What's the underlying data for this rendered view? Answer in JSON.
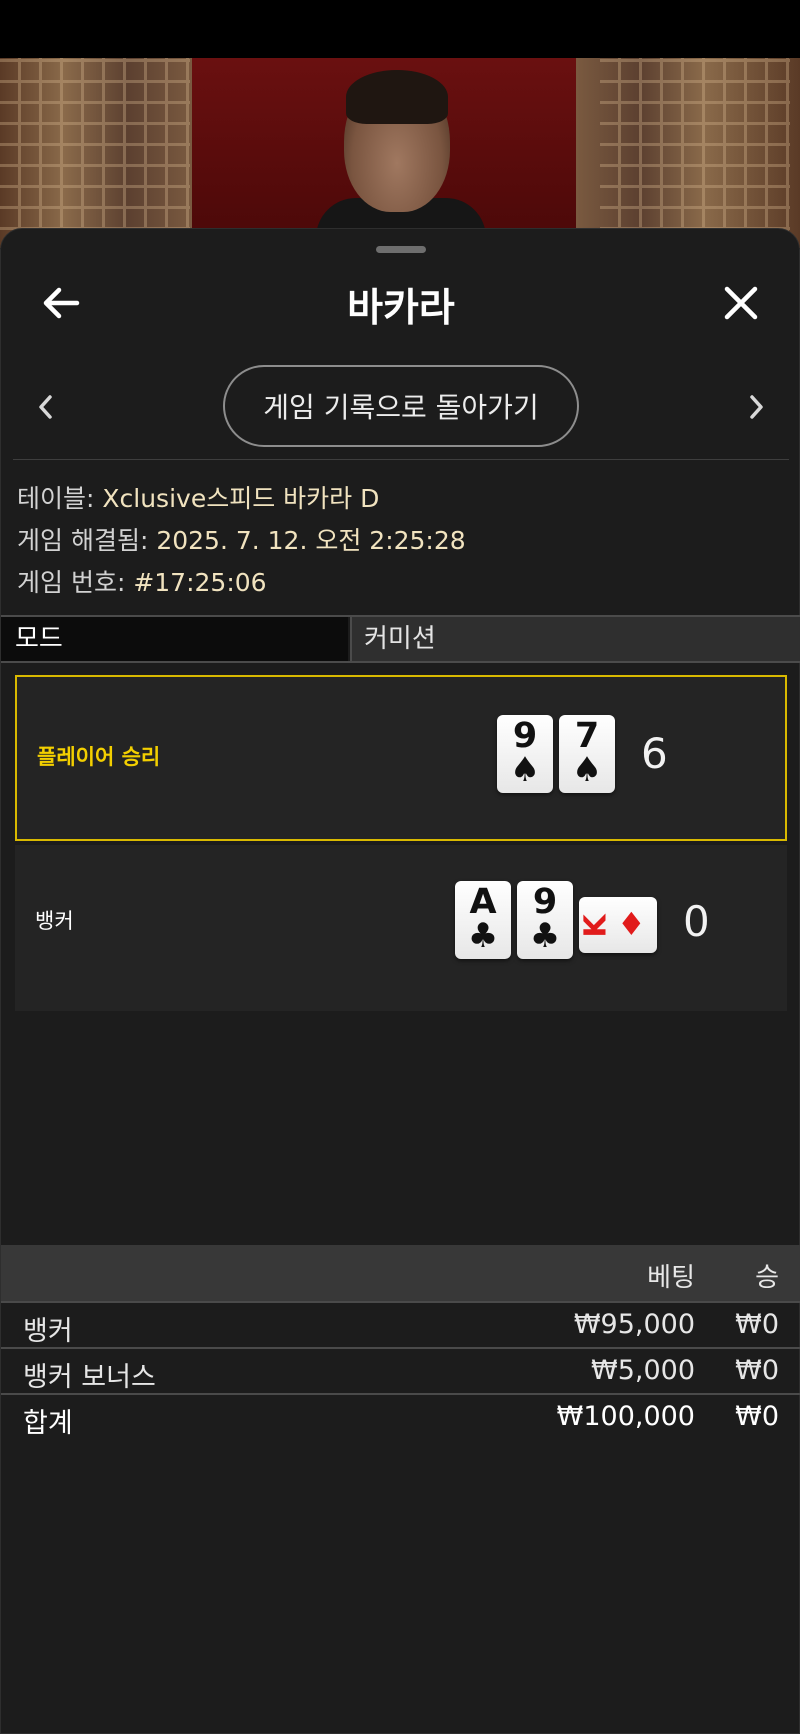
{
  "header": {
    "title": "바카라"
  },
  "navigation": {
    "back_to_history": "게임 기록으로 돌아가기"
  },
  "info": {
    "table_label": "테이블:",
    "table_value": "Xclusive스피드 바카라 D",
    "resolved_label": "게임 해결됨:",
    "resolved_value": "2025. 7. 12. 오전 2:25:28",
    "round_label": "게임 번호:",
    "round_value": "#17:25:06"
  },
  "mode": {
    "label": "모드",
    "value": "커미션"
  },
  "results": {
    "player": {
      "label": "플레이어 승리",
      "score": "6",
      "cards": [
        {
          "rank": "9",
          "suit": "♠"
        },
        {
          "rank": "7",
          "suit": "♠"
        }
      ]
    },
    "banker": {
      "label": "뱅커",
      "score": "0",
      "cards": [
        {
          "rank": "A",
          "suit": "♣"
        },
        {
          "rank": "9",
          "suit": "♣"
        },
        {
          "rank": "K",
          "suit": "♦"
        }
      ]
    }
  },
  "bets": {
    "col_bet": "베팅",
    "col_win": "승",
    "rows": [
      {
        "name": "뱅커",
        "bet": "₩95,000",
        "win": "₩0"
      },
      {
        "name": "뱅커 보너스",
        "bet": "₩5,000",
        "win": "₩0"
      }
    ],
    "total": {
      "name": "합계",
      "bet": "₩100,000",
      "win": "₩0"
    }
  },
  "colors": {
    "accent_gold": "#d9b900",
    "sheet_bg": "#1c1c1c",
    "info_value": "#f1e3bf"
  }
}
